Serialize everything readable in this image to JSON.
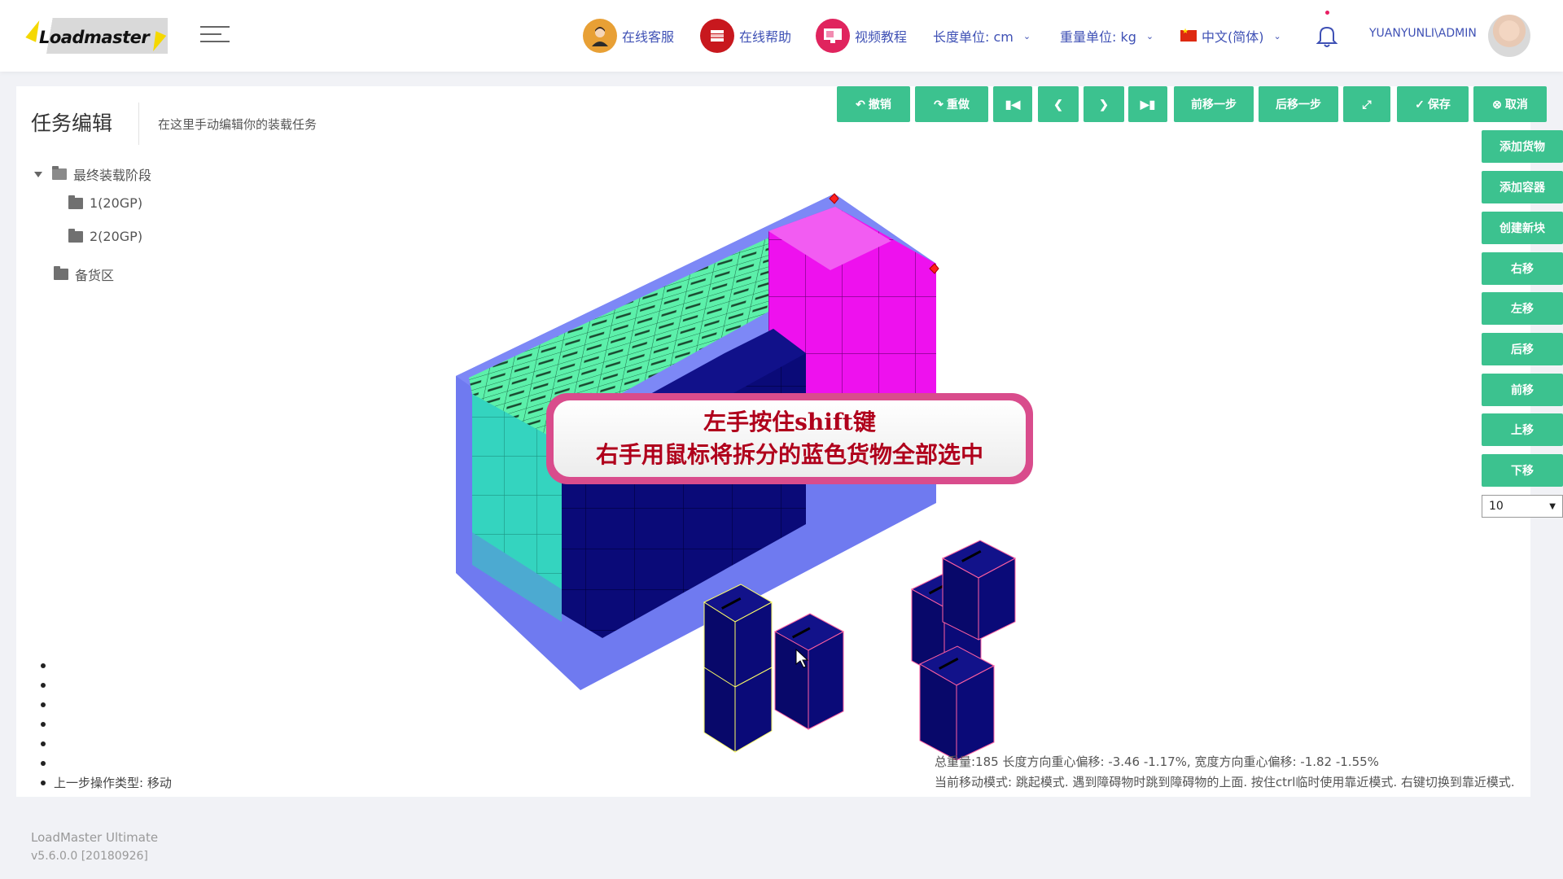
{
  "header": {
    "logo_text": "Loadmaster",
    "online_service": "在线客服",
    "online_help": "在线帮助",
    "video_tutorial": "视频教程",
    "length_unit": "长度单位: cm",
    "weight_unit": "重量单位: kg",
    "language": "中文(简体)",
    "username": "YUANYUNLI\\ADMIN"
  },
  "page": {
    "title": "任务编辑",
    "subtitle": "在这里手动编辑你的装载任务"
  },
  "tree": {
    "root": "最终装载阶段",
    "children": [
      "1(20GP)",
      "2(20GP)"
    ],
    "staging": "备货区"
  },
  "toolbar": {
    "undo": "撤销",
    "redo": "重做",
    "step_forward": "前移一步",
    "step_back": "后移一步",
    "save": "保存",
    "cancel": "取消"
  },
  "side_buttons": [
    "添加货物",
    "添加容器",
    "创建新块",
    "右移",
    "左移",
    "后移",
    "前移",
    "上移",
    "下移"
  ],
  "step_value": "10",
  "hint": {
    "line1": "左手按住shift键",
    "line2": "右手用鼠标将拆分的蓝色货物全部选中"
  },
  "status": {
    "line1": "总重量:185 长度方向重心偏移: -3.46 -1.17%, 宽度方向重心偏移: -1.82 -1.55%",
    "line2": "当前移动模式: 跳起模式. 遇到障碍物时跳到障碍物的上面. 按住ctrl临时使用靠近模式. 右键切换到靠近模式."
  },
  "last_operation": "上一步操作类型: 移动",
  "footer": {
    "product": "LoadMaster Ultimate",
    "version": "v5.6.0.0 [20180926]"
  },
  "colors": {
    "accent_green": "#3cc28f",
    "container_blue": "#6f7af0",
    "cargo_navy": "#0a0a78",
    "cargo_mint": "#4ee8a4",
    "cargo_teal": "#3ad8c8",
    "cargo_magenta": "#ee11ee",
    "hint_border": "#d94c8c"
  }
}
